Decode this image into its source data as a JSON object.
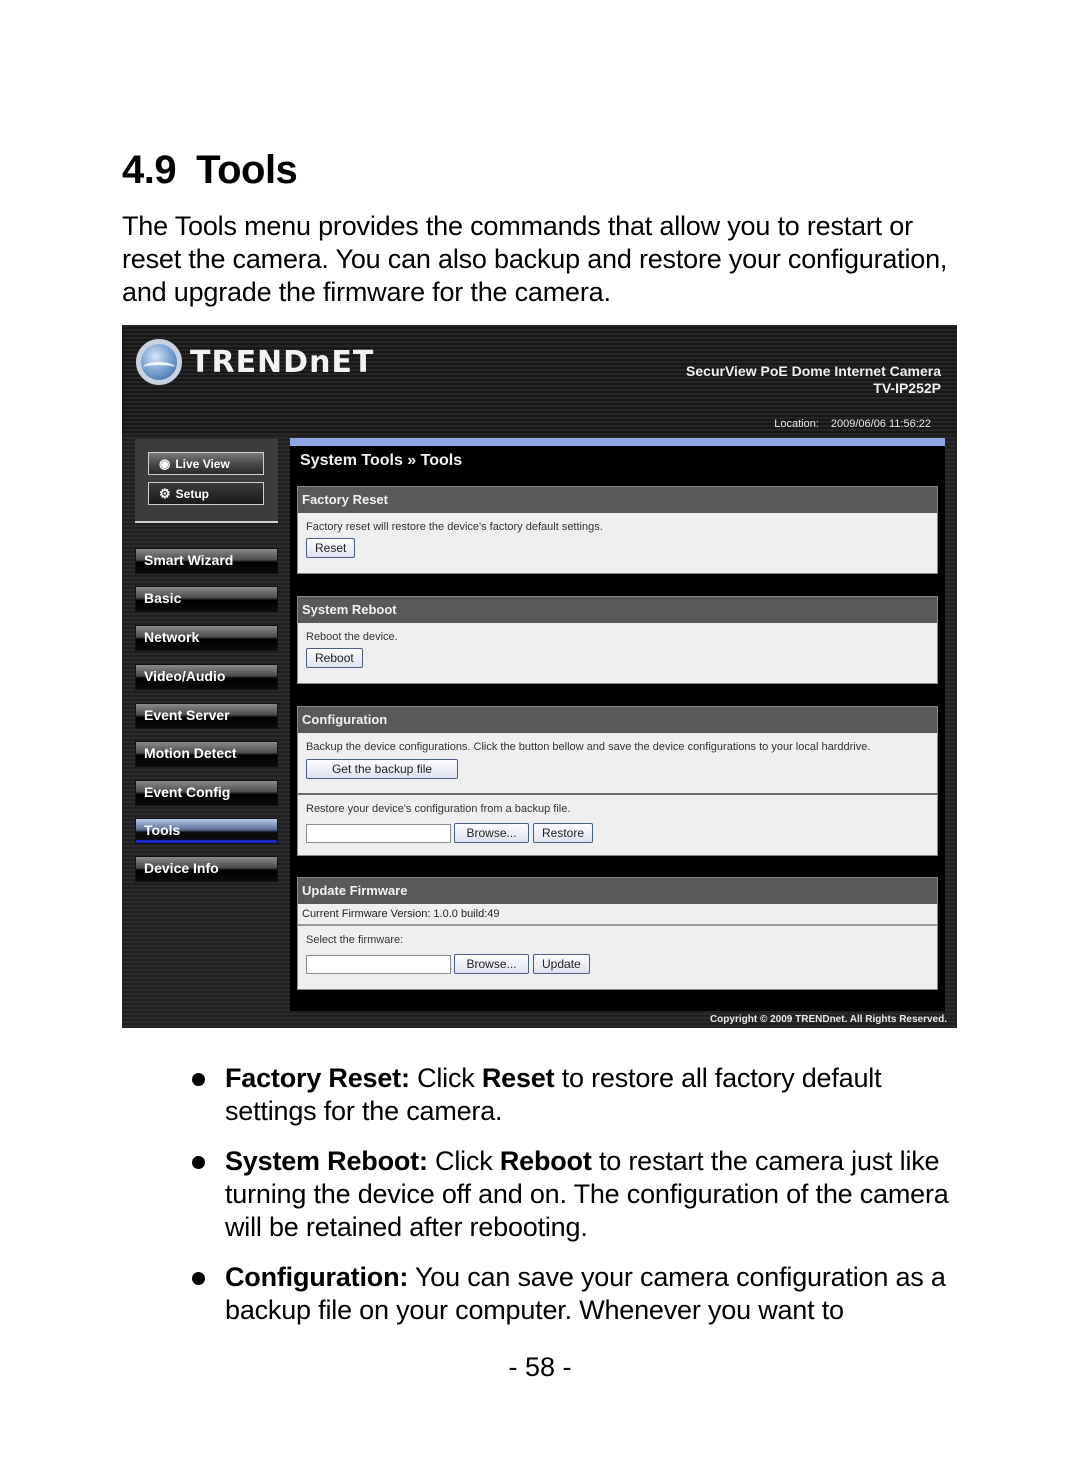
{
  "document": {
    "section_number": "4.9",
    "section_title": "Tools",
    "intro": "The Tools menu provides the commands that allow you to restart or reset the camera. You can also backup and restore your configuration, and upgrade the firmware for the camera.",
    "bullets": [
      {
        "term": "Factory Reset:",
        "pre": " Click ",
        "bold": "Reset",
        "post": " to restore all factory default settings for the camera."
      },
      {
        "term": "System Reboot:",
        "pre": " Click ",
        "bold": "Reboot",
        "post": " to restart the camera just like turning the device off and on. The configuration of the camera will be retained after rebooting."
      },
      {
        "term": "Configuration:",
        "pre": " You can save your camera configuration as a backup file on your computer. Whenever you want to",
        "bold": "",
        "post": ""
      }
    ],
    "page_number": "- 58 -"
  },
  "camera_ui": {
    "brand": "TRENDnET",
    "product_name": "SecurView PoE Dome Internet Camera",
    "model": "TV-IP252P",
    "location_label": "Location:",
    "datetime": "2009/06/06 11:56:22",
    "top_nav": [
      {
        "label": "Live View",
        "icon": "eye-icon"
      },
      {
        "label": "Setup",
        "icon": "gears-icon"
      }
    ],
    "menu": [
      {
        "label": "Smart Wizard",
        "active": false
      },
      {
        "label": "Basic",
        "active": false
      },
      {
        "label": "Network",
        "active": false
      },
      {
        "label": "Video/Audio",
        "active": false
      },
      {
        "label": "Event Server",
        "active": false
      },
      {
        "label": "Motion Detect",
        "active": false
      },
      {
        "label": "Event Config",
        "active": false
      },
      {
        "label": "Tools",
        "active": true
      },
      {
        "label": "Device Info",
        "active": false
      }
    ],
    "breadcrumb": "System Tools » Tools",
    "factory_reset": {
      "title": "Factory Reset",
      "description": "Factory reset will restore the device's factory default settings.",
      "button": "Reset"
    },
    "system_reboot": {
      "title": "System Reboot",
      "description": "Reboot the device.",
      "button": "Reboot"
    },
    "configuration": {
      "title": "Configuration",
      "backup_description": "Backup the device configurations. Click the button bellow and save the device configurations to your local harddrive.",
      "backup_button": "Get the backup file",
      "restore_description": "Restore your device's configuration from a backup file.",
      "restore_file_value": "",
      "browse_button": "Browse...",
      "restore_button": "Restore"
    },
    "update_firmware": {
      "title": "Update Firmware",
      "current_version": "Current Firmware Version: 1.0.0 build:49",
      "select_label": "Select the firmware:",
      "file_value": "",
      "browse_button": "Browse...",
      "update_button": "Update"
    },
    "copyright": "Copyright © 2009 TRENDnet. All Rights Reserved.",
    "colors": {
      "active_menu_accent": "#1a2cc8",
      "content_top_bar": "#8ea6e6",
      "section_header": "#595959",
      "section_body": "#efefef"
    }
  }
}
